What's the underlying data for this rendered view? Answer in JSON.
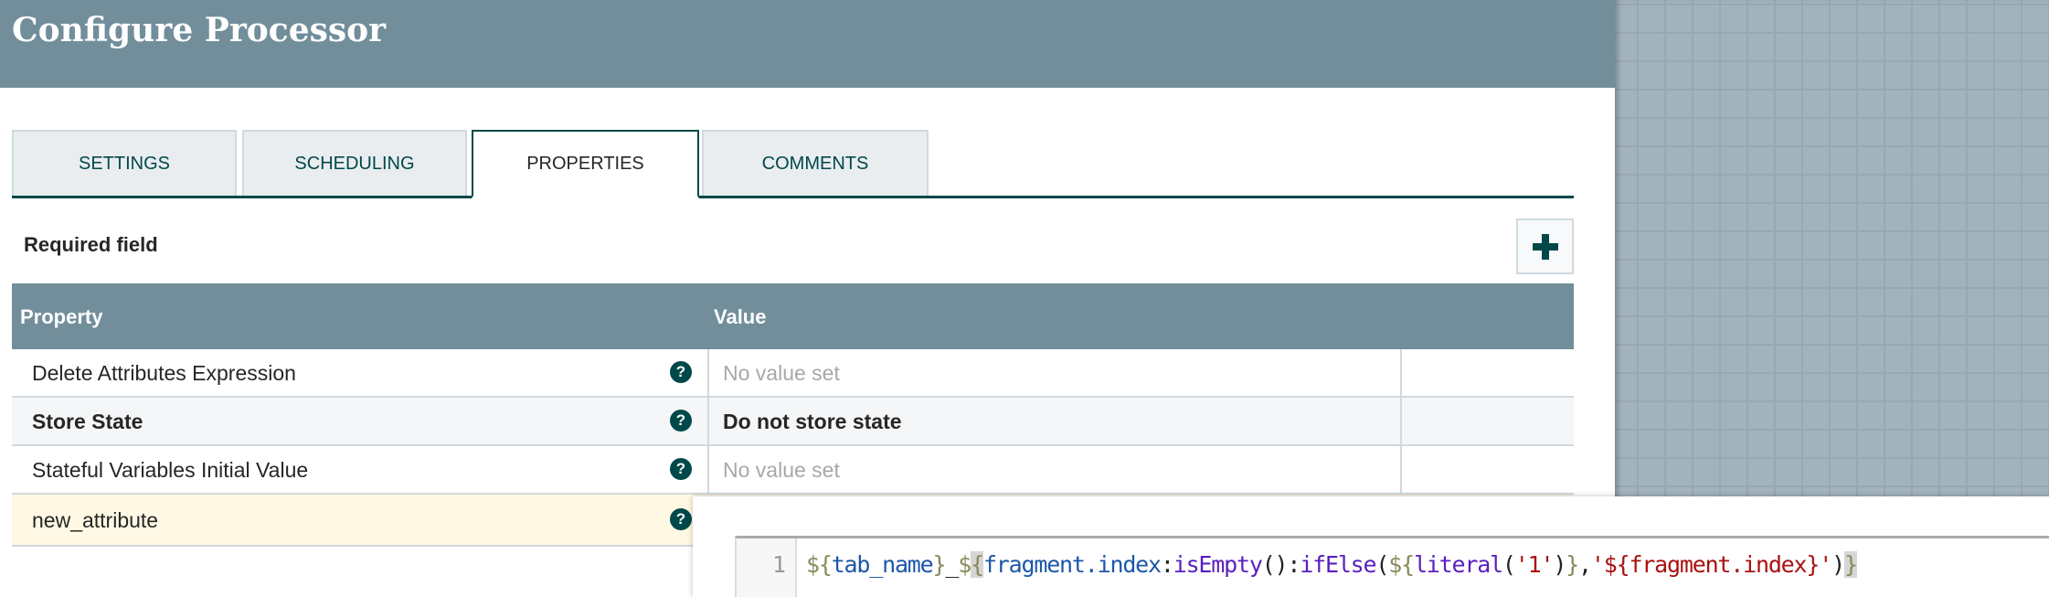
{
  "dialog": {
    "title": "Configure Processor"
  },
  "tabs": [
    {
      "label": "SETTINGS",
      "active": false
    },
    {
      "label": "SCHEDULING",
      "active": false
    },
    {
      "label": "PROPERTIES",
      "active": true
    },
    {
      "label": "COMMENTS",
      "active": false
    }
  ],
  "properties": {
    "required_label": "Required field",
    "add_icon": "plus-icon",
    "columns": {
      "property": "Property",
      "value": "Value"
    },
    "rows": [
      {
        "name": "Delete Attributes Expression",
        "value": "No value set",
        "help": "?"
      },
      {
        "name": "Store State",
        "value": "Do not store state",
        "help": "?"
      },
      {
        "name": "Stateful Variables Initial Value",
        "value": "No value set",
        "help": "?"
      },
      {
        "name": "new_attribute",
        "value": "",
        "help": "?"
      }
    ]
  },
  "editor": {
    "line_number": "1",
    "tokens": [
      {
        "t": "${",
        "c": "#8a8a5c"
      },
      {
        "t": "tab_name",
        "c": "#1c57a8"
      },
      {
        "t": "}",
        "c": "#8a8a5c"
      },
      {
        "t": "_",
        "c": "#222222"
      },
      {
        "t": "$",
        "c": "#8a8a5c"
      },
      {
        "t": "{",
        "c": "#8a8a5c",
        "m": true
      },
      {
        "t": "fragment.index",
        "c": "#1c57a8"
      },
      {
        "t": ":",
        "c": "#222222"
      },
      {
        "t": "isEmpty",
        "c": "#5a1ec0"
      },
      {
        "t": "()",
        "c": "#222222"
      },
      {
        "t": ":",
        "c": "#222222"
      },
      {
        "t": "ifElse",
        "c": "#5a1ec0"
      },
      {
        "t": "(",
        "c": "#222222"
      },
      {
        "t": "${",
        "c": "#8a8a5c"
      },
      {
        "t": "literal",
        "c": "#5a1ec0"
      },
      {
        "t": "(",
        "c": "#222222"
      },
      {
        "t": "'1'",
        "c": "#aa1111"
      },
      {
        "t": ")",
        "c": "#222222"
      },
      {
        "t": "}",
        "c": "#8a8a5c"
      },
      {
        "t": ",",
        "c": "#222222"
      },
      {
        "t": "'${fragment.index}'",
        "c": "#aa1111"
      },
      {
        "t": ")",
        "c": "#222222"
      },
      {
        "t": "}",
        "c": "#8a8a5c",
        "m": true
      }
    ]
  }
}
